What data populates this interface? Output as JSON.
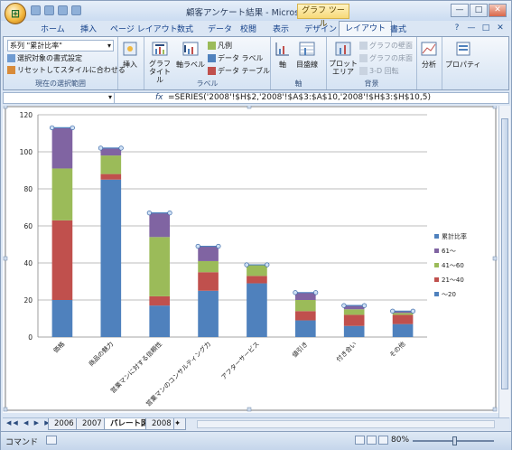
{
  "window": {
    "title": "顧客アンケート結果 - Microsoft Excel",
    "context_tab": "グラフ ツール",
    "controls": [
      "—",
      "□",
      "✕"
    ]
  },
  "tabs": [
    "ホーム",
    "挿入",
    "ページ レイアウト",
    "数式",
    "データ",
    "校閲",
    "表示",
    "デザイン",
    "レイアウト",
    "書式"
  ],
  "active_tab": "レイアウト",
  "ribbon": {
    "selection_group": {
      "series_label": "系列 \"累計比率\"",
      "format_selection": "選択対象の書式設定",
      "reset_style": "リセットしてスタイルに合わせる",
      "group_label": "現在の選択範囲"
    },
    "insert_label": "挿入",
    "labels_group": {
      "chart_title": "グラフ タイトル",
      "axis_titles": "軸ラベル",
      "legend": "凡例",
      "data_labels": "データ ラベル",
      "data_table": "データ テーブル",
      "group_label": "ラベル"
    },
    "axes_group": {
      "axes": "軸",
      "gridlines": "目盛線",
      "group_label": "軸"
    },
    "background_group": {
      "plot_area": "プロット エリア",
      "chart_wall": "グラフの壁面",
      "chart_floor": "グラフの床面",
      "rotation": "3-D 回転",
      "group_label": "背景"
    },
    "analysis": "分析",
    "properties": "プロパティ"
  },
  "formula_bar": {
    "fx": "fx",
    "formula": "=SERIES('2008'!$H$2,'2008'!$A$3:$A$10,'2008'!$H$3:$H$10,5)"
  },
  "chart_data": {
    "type": "bar",
    "stacked": true,
    "categories": [
      "価格",
      "商品の魅力",
      "営業マンに対する信頼性",
      "営業マンのコンサルティング力",
      "アフターサービス",
      "値引き",
      "付き合い",
      "その他"
    ],
    "series": [
      {
        "name": "～20",
        "color": "#4f81bd",
        "values": [
          20,
          85,
          17,
          25,
          29,
          9,
          6,
          7
        ]
      },
      {
        "name": "21～40",
        "color": "#c0504d",
        "values": [
          43,
          3,
          5,
          10,
          4,
          5,
          6,
          5
        ]
      },
      {
        "name": "41～60",
        "color": "#9bbb59",
        "values": [
          28,
          10,
          32,
          6,
          6,
          6,
          3,
          1
        ]
      },
      {
        "name": "61～",
        "color": "#8064a2",
        "values": [
          22,
          4,
          13,
          8,
          0,
          4,
          2,
          1
        ]
      },
      {
        "name": "累計比率",
        "color": "#4f81bd"
      }
    ],
    "ylim": [
      0,
      120
    ],
    "yticks": [
      0,
      20,
      40,
      60,
      80,
      100,
      120
    ],
    "grid": true,
    "legend_position": "right"
  },
  "sheet_tabs": [
    "2006",
    "2007",
    "パレート図",
    "2008"
  ],
  "active_sheet": "パレート図",
  "status": {
    "mode": "コマンド",
    "zoom": "80%"
  }
}
